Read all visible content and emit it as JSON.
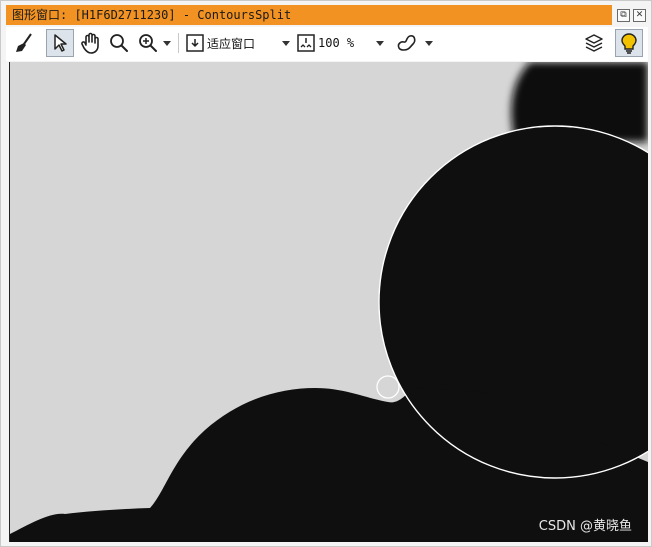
{
  "window": {
    "title": "图形窗口: [H1F6D2711230] - ContoursSplit",
    "restore_icon": "restore-icon",
    "close_icon": "close-icon"
  },
  "toolbar": {
    "tools": [
      {
        "name": "clear-brush-icon"
      },
      {
        "name": "pointer-select-icon",
        "active": true
      },
      {
        "name": "pan-hand-icon"
      },
      {
        "name": "magnifier-icon"
      },
      {
        "name": "zoom-in-icon"
      }
    ],
    "fit_mode": "适应窗口",
    "zoom_level": "100 %",
    "draw_mode_icon": "region-draw-icon",
    "layers_icon": "layers-icon",
    "lightbulb_icon": "lightbulb-icon"
  },
  "colors": {
    "title_bar": "#f29222",
    "canvas_background": "#d6d6d6",
    "object": "#0f0f0f",
    "contour": "#ffffff",
    "lightbulb": "#f2c200"
  },
  "watermark": "CSDN @黄晓鱼"
}
